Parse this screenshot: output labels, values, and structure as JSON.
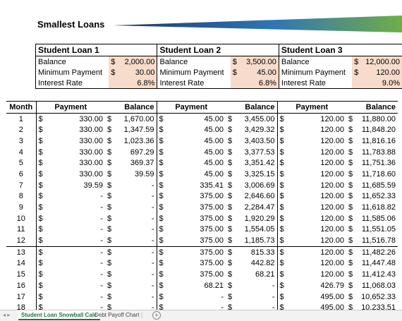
{
  "title": "Smallest Loans",
  "loans": [
    {
      "name": "Student Loan 1",
      "balance_label": "Balance",
      "balance_cur": "$",
      "balance": "2,000.00",
      "min_label": "Minimum Payment",
      "min_cur": "$",
      "min": "30.00",
      "rate_label": "Interest Rate",
      "rate": "6.8%"
    },
    {
      "name": "Student Loan 2",
      "balance_label": "Balance",
      "balance_cur": "$",
      "balance": "3,500.00",
      "min_label": "Minimum Payment",
      "min_cur": "$",
      "min": "45.00",
      "rate_label": "Interest Rate",
      "rate": "6.8%"
    },
    {
      "name": "Student Loan 3",
      "balance_label": "Balance",
      "balance_cur": "$",
      "balance": "12,000.00",
      "min_label": "Minimum Payment",
      "min_cur": "$",
      "min": "120.00",
      "rate_label": "Interest Rate",
      "rate": "9.0%"
    }
  ],
  "schedule": {
    "headers": [
      "Month",
      "Payment",
      "Balance",
      "Payment",
      "Balance",
      "Payment",
      "Balance"
    ],
    "currency": "$",
    "rows": [
      [
        "1",
        "330.00",
        "1,670.00",
        "45.00",
        "3,455.00",
        "120.00",
        "11,880.00"
      ],
      [
        "2",
        "330.00",
        "1,347.59",
        "45.00",
        "3,429.32",
        "120.00",
        "11,848.20"
      ],
      [
        "3",
        "330.00",
        "1,023.36",
        "45.00",
        "3,403.50",
        "120.00",
        "11,816.16"
      ],
      [
        "4",
        "330.00",
        "697.29",
        "45.00",
        "3,377.53",
        "120.00",
        "11,783.88"
      ],
      [
        "5",
        "330.00",
        "369.37",
        "45.00",
        "3,351.42",
        "120.00",
        "11,751.36"
      ],
      [
        "6",
        "330.00",
        "39.59",
        "45.00",
        "3,325.15",
        "120.00",
        "11,718.60"
      ],
      [
        "7",
        "39.59",
        "-",
        "335.41",
        "3,006.69",
        "120.00",
        "11,685.59"
      ],
      [
        "8",
        "-",
        "-",
        "375.00",
        "2,646.60",
        "120.00",
        "11,652.33"
      ],
      [
        "9",
        "-",
        "-",
        "375.00",
        "2,284.47",
        "120.00",
        "11,618.82"
      ],
      [
        "10",
        "-",
        "-",
        "375.00",
        "1,920.29",
        "120.00",
        "11,585.06"
      ],
      [
        "11",
        "-",
        "-",
        "375.00",
        "1,554.05",
        "120.00",
        "11,551.05"
      ],
      [
        "12",
        "-",
        "-",
        "375.00",
        "1,185.73",
        "120.00",
        "11,516.78"
      ],
      [
        "13",
        "-",
        "-",
        "375.00",
        "815.33",
        "120.00",
        "11,482.26"
      ],
      [
        "14",
        "-",
        "-",
        "375.00",
        "442.82",
        "120.00",
        "11,447.48"
      ],
      [
        "15",
        "-",
        "-",
        "375.00",
        "68.21",
        "120.00",
        "11,412.43"
      ],
      [
        "16",
        "-",
        "-",
        "68.21",
        "-",
        "426.79",
        "11,068.03"
      ],
      [
        "17",
        "-",
        "-",
        "-",
        "-",
        "495.00",
        "10,652.33"
      ],
      [
        "18",
        "-",
        "-",
        "-",
        "-",
        "495.00",
        "10,233.51"
      ]
    ]
  },
  "tabs": {
    "active": "Student Loan Snowball Calc",
    "other": "Debt Payoff Chart",
    "add": "+"
  },
  "colors": {
    "highlight": "#f8dccb",
    "banner_start": "#1f3864",
    "banner_end": "#70ad47",
    "accent": "#217346"
  }
}
